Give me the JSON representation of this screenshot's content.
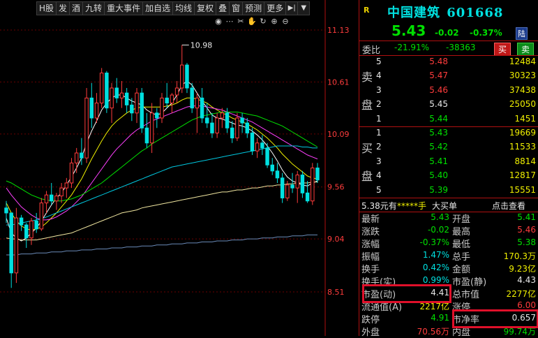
{
  "toolbar": {
    "items": [
      "H股",
      "发",
      "酒",
      "九转",
      "重大事件",
      "加自选",
      "均线",
      "复权",
      "叠",
      "窗",
      "预测",
      "更多"
    ],
    "dropdown_arrow": "▼",
    "collapse_arrow": "▶|"
  },
  "chart_icons": [
    "eye-icon",
    "dots-icon",
    "scissors-icon",
    "hand-icon",
    "refresh-icon",
    "zoom-in-icon",
    "zoom-out-icon"
  ],
  "chart_data": {
    "type": "candlestick",
    "y_ticks": [
      "11.13",
      "10.61",
      "10.09",
      "9.56",
      "9.04",
      "8.51"
    ],
    "ylim": [
      8.51,
      11.13
    ],
    "annotation": "10.98",
    "ohlc": [
      [
        9.35,
        9.42,
        9.2,
        9.3
      ],
      [
        9.3,
        9.3,
        8.55,
        8.7
      ],
      [
        8.7,
        9.35,
        8.6,
        9.25
      ],
      [
        9.25,
        9.28,
        9.12,
        9.18
      ],
      [
        9.18,
        9.2,
        8.95,
        9.05
      ],
      [
        9.05,
        9.25,
        8.98,
        9.22
      ],
      [
        9.22,
        9.3,
        9.1,
        9.14
      ],
      [
        9.14,
        9.45,
        9.12,
        9.4
      ],
      [
        9.4,
        9.52,
        9.3,
        9.48
      ],
      [
        9.48,
        9.6,
        9.38,
        9.42
      ],
      [
        9.42,
        9.5,
        9.33,
        9.47
      ],
      [
        9.47,
        9.6,
        9.4,
        9.55
      ],
      [
        9.55,
        9.65,
        9.45,
        9.6
      ],
      [
        9.6,
        9.85,
        9.55,
        9.8
      ],
      [
        9.8,
        9.95,
        9.7,
        9.9
      ],
      [
        9.9,
        10.05,
        9.78,
        9.85
      ],
      [
        9.85,
        10.55,
        9.8,
        10.45
      ],
      [
        10.45,
        10.6,
        10.15,
        10.25
      ],
      [
        10.25,
        10.5,
        10.2,
        10.4
      ],
      [
        10.4,
        10.75,
        10.35,
        10.7
      ],
      [
        10.7,
        10.72,
        10.3,
        10.35
      ],
      [
        10.35,
        10.6,
        10.2,
        10.55
      ],
      [
        10.55,
        10.65,
        10.4,
        10.45
      ],
      [
        10.45,
        10.62,
        10.35,
        10.5
      ],
      [
        10.5,
        10.55,
        10.3,
        10.38
      ],
      [
        10.38,
        10.45,
        10.22,
        10.3
      ],
      [
        10.3,
        10.55,
        10.2,
        10.5
      ],
      [
        10.5,
        10.55,
        10.1,
        10.15
      ],
      [
        10.15,
        10.3,
        9.95,
        10.0
      ],
      [
        10.0,
        10.4,
        9.9,
        10.3
      ],
      [
        10.3,
        10.35,
        10.15,
        10.25
      ],
      [
        10.25,
        10.5,
        10.2,
        10.45
      ],
      [
        10.45,
        10.6,
        10.35,
        10.4
      ],
      [
        10.4,
        10.5,
        10.3,
        10.48
      ],
      [
        10.48,
        10.62,
        10.4,
        10.55
      ],
      [
        10.55,
        10.98,
        10.5,
        10.78
      ],
      [
        10.78,
        10.8,
        10.5,
        10.55
      ],
      [
        10.55,
        10.6,
        10.3,
        10.35
      ],
      [
        10.35,
        10.5,
        10.1,
        10.45
      ],
      [
        10.45,
        10.55,
        10.2,
        10.25
      ],
      [
        10.25,
        10.4,
        10.15,
        10.2
      ],
      [
        10.2,
        10.3,
        10.05,
        10.1
      ],
      [
        10.1,
        10.3,
        10.05,
        10.25
      ],
      [
        10.25,
        10.35,
        10.15,
        10.3
      ],
      [
        10.3,
        10.35,
        10.1,
        10.15
      ],
      [
        10.15,
        10.22,
        10.0,
        10.05
      ],
      [
        10.05,
        10.3,
        10.02,
        10.25
      ],
      [
        10.25,
        10.3,
        10.1,
        10.2
      ],
      [
        10.2,
        10.25,
        10.05,
        10.1
      ],
      [
        10.1,
        10.15,
        9.88,
        9.92
      ],
      [
        9.92,
        10.05,
        9.85,
        10.0
      ],
      [
        10.0,
        10.08,
        9.88,
        9.95
      ],
      [
        9.95,
        10.0,
        9.75,
        9.78
      ],
      [
        9.78,
        9.85,
        9.68,
        9.72
      ],
      [
        9.72,
        9.8,
        9.6,
        9.65
      ],
      [
        9.65,
        9.7,
        9.4,
        9.45
      ],
      [
        9.45,
        9.62,
        9.42,
        9.58
      ],
      [
        9.58,
        9.7,
        9.5,
        9.55
      ],
      [
        9.55,
        9.72,
        9.4,
        9.68
      ],
      [
        9.68,
        9.72,
        9.45,
        9.5
      ],
      [
        9.5,
        9.62,
        9.4,
        9.42
      ],
      [
        9.42,
        9.8,
        9.38,
        9.75
      ],
      [
        9.75,
        9.8,
        9.6,
        9.63
      ]
    ],
    "ma_lines": [
      {
        "color": "#ffffff",
        "values": [
          9.25,
          9.1,
          9.05,
          9.02,
          9.05,
          9.1,
          9.15,
          9.22,
          9.3,
          9.38,
          9.45,
          9.5,
          9.58,
          9.66,
          9.75,
          9.85,
          10.0,
          10.12,
          10.22,
          10.33,
          10.4,
          10.45,
          10.48,
          10.48,
          10.45,
          10.42,
          10.4,
          10.38,
          10.33,
          10.3,
          10.28,
          10.3,
          10.35,
          10.4,
          10.48,
          10.58,
          10.62,
          10.58,
          10.5,
          10.42,
          10.35,
          10.28,
          10.25,
          10.24,
          10.22,
          10.2,
          10.18,
          10.17,
          10.15,
          10.12,
          10.08,
          10.03,
          9.97,
          9.9,
          9.82,
          9.73,
          9.66,
          9.62,
          9.6,
          9.58,
          9.57,
          9.6,
          9.62
        ]
      },
      {
        "color": "#f0f000",
        "values": [
          9.4,
          9.3,
          9.22,
          9.17,
          9.14,
          9.13,
          9.14,
          9.16,
          9.2,
          9.25,
          9.3,
          9.36,
          9.42,
          9.48,
          9.56,
          9.64,
          9.74,
          9.84,
          9.93,
          10.02,
          10.1,
          10.17,
          10.22,
          10.26,
          10.3,
          10.33,
          10.35,
          10.36,
          10.36,
          10.36,
          10.36,
          10.36,
          10.37,
          10.38,
          10.4,
          10.43,
          10.45,
          10.45,
          10.44,
          10.42,
          10.4,
          10.36,
          10.33,
          10.3,
          10.28,
          10.25,
          10.23,
          10.21,
          10.19,
          10.16,
          10.13,
          10.09,
          10.05,
          10.0,
          9.95,
          9.89,
          9.84,
          9.79,
          9.75,
          9.71,
          9.67,
          9.65,
          9.64
        ]
      },
      {
        "color": "#ff40ff",
        "values": [
          9.55,
          9.48,
          9.42,
          9.36,
          9.32,
          9.28,
          9.25,
          9.23,
          9.23,
          9.24,
          9.26,
          9.29,
          9.32,
          9.36,
          9.41,
          9.46,
          9.53,
          9.6,
          9.67,
          9.74,
          9.81,
          9.88,
          9.94,
          9.99,
          10.04,
          10.09,
          10.13,
          10.16,
          10.19,
          10.22,
          10.24,
          10.26,
          10.28,
          10.3,
          10.32,
          10.34,
          10.36,
          10.37,
          10.37,
          10.37,
          10.36,
          10.35,
          10.34,
          10.33,
          10.31,
          10.29,
          10.27,
          10.25,
          10.23,
          10.21,
          10.18,
          10.15,
          10.12,
          10.09,
          10.06,
          10.03,
          10.0,
          9.97,
          9.94,
          9.91,
          9.88,
          9.86,
          9.84
        ]
      },
      {
        "color": "#00e000",
        "values": [
          9.62,
          9.6,
          9.57,
          9.54,
          9.51,
          9.48,
          9.46,
          9.44,
          9.43,
          9.42,
          9.42,
          9.42,
          9.43,
          9.44,
          9.46,
          9.48,
          9.51,
          9.54,
          9.57,
          9.6,
          9.64,
          9.68,
          9.72,
          9.76,
          9.8,
          9.84,
          9.88,
          9.92,
          9.95,
          9.99,
          10.02,
          10.05,
          10.08,
          10.11,
          10.14,
          10.17,
          10.2,
          10.23,
          10.25,
          10.27,
          10.28,
          10.29,
          10.3,
          10.31,
          10.31,
          10.31,
          10.31,
          10.3,
          10.29,
          10.28,
          10.27,
          10.25,
          10.23,
          10.21,
          10.19,
          10.17,
          10.14,
          10.11,
          10.08,
          10.05,
          10.02,
          9.99,
          9.96
        ]
      },
      {
        "color": "#00c8e0",
        "values": [
          9.18,
          9.18,
          9.19,
          9.2,
          9.21,
          9.22,
          9.23,
          9.24,
          9.26,
          9.28,
          9.3,
          9.32,
          9.34,
          9.36,
          9.38,
          9.4,
          9.42,
          9.44,
          9.46,
          9.48,
          9.5,
          9.52,
          9.54,
          9.56,
          9.58,
          9.6,
          9.62,
          9.64,
          9.66,
          9.68,
          9.7,
          9.72,
          9.74,
          9.76,
          9.77,
          9.78,
          9.79,
          9.8,
          9.81,
          9.82,
          9.83,
          9.84,
          9.85,
          9.86,
          9.87,
          9.88,
          9.89,
          9.9,
          9.91,
          9.92,
          9.93,
          9.94,
          9.95,
          9.96,
          9.97,
          9.97,
          9.97,
          9.97,
          9.97,
          9.96,
          9.96,
          9.95,
          9.95
        ]
      },
      {
        "color": "#f0e6a0",
        "values": [
          9.05,
          9.04,
          9.04,
          9.03,
          9.03,
          9.03,
          9.03,
          9.04,
          9.05,
          9.06,
          9.07,
          9.08,
          9.09,
          9.1,
          9.12,
          9.14,
          9.16,
          9.18,
          9.2,
          9.22,
          9.24,
          9.26,
          9.28,
          9.3,
          9.31,
          9.32,
          9.33,
          9.35,
          9.36,
          9.37,
          9.38,
          9.39,
          9.4,
          9.41,
          9.42,
          9.43,
          9.44,
          9.45,
          9.46,
          9.47,
          9.48,
          9.49,
          9.5,
          9.51,
          9.51,
          9.52,
          9.53,
          9.53,
          9.54,
          9.55,
          9.55,
          9.56,
          9.57,
          9.57,
          9.58,
          9.58,
          9.59,
          9.59,
          9.6,
          9.6,
          9.6,
          9.61,
          9.61
        ]
      },
      {
        "color": "#6a8ab8",
        "values": [
          8.88,
          8.88,
          8.88,
          8.89,
          8.89,
          8.89,
          8.9,
          8.9,
          8.9,
          8.91,
          8.91,
          8.91,
          8.92,
          8.92,
          8.92,
          8.93,
          8.93,
          8.93,
          8.94,
          8.94,
          8.94,
          8.95,
          8.95,
          8.95,
          8.96,
          8.96,
          8.96,
          8.97,
          8.97,
          8.97,
          8.98,
          8.98,
          8.98,
          8.99,
          8.99,
          8.99,
          9.0,
          9.0,
          9.0,
          9.01,
          9.01,
          9.01,
          9.02,
          9.02,
          9.02,
          9.03,
          9.03,
          9.03,
          9.04,
          9.04,
          9.04,
          9.05,
          9.05,
          9.05,
          9.06,
          9.06,
          9.06,
          9.07,
          9.07,
          9.07,
          9.08,
          9.08,
          9.08
        ]
      }
    ]
  },
  "quote": {
    "badge": "R",
    "name": "中国建筑",
    "code": "601668",
    "price": "5.43",
    "change": "-0.02",
    "change_pct": "-0.37%",
    "market_tag": "陆",
    "weibi_label": "委比",
    "weibi_pct": "-21.91%",
    "weicha": "-38363",
    "buy_btn": "买",
    "sell_btn": "卖",
    "sell_side_label": [
      "卖",
      "盘"
    ],
    "buy_side_label": [
      "买",
      "盘"
    ],
    "sells": [
      {
        "level": "5",
        "price": "5.48",
        "vol": "12484"
      },
      {
        "level": "4",
        "price": "5.47",
        "vol": "30323"
      },
      {
        "level": "3",
        "price": "5.46",
        "vol": "37438"
      },
      {
        "level": "2",
        "price": "5.45",
        "vol": "25050"
      },
      {
        "level": "1",
        "price": "5.44",
        "vol": "1451"
      }
    ],
    "buys": [
      {
        "level": "1",
        "price": "5.43",
        "vol": "19669"
      },
      {
        "level": "2",
        "price": "5.42",
        "vol": "11533"
      },
      {
        "level": "3",
        "price": "5.41",
        "vol": "8814"
      },
      {
        "level": "4",
        "price": "5.40",
        "vol": "12817"
      },
      {
        "level": "5",
        "price": "5.39",
        "vol": "15551"
      }
    ],
    "bigorder": {
      "text1": "5.38元有",
      "text2": "*****手",
      "text3": "大买单",
      "link": "点击查看"
    },
    "stats": [
      {
        "l1": "最新",
        "v1": "5.43",
        "c1": "green",
        "l2": "开盘",
        "v2": "5.41",
        "c2": "green"
      },
      {
        "l1": "涨跌",
        "v1": "-0.02",
        "c1": "green",
        "l2": "最高",
        "v2": "5.46",
        "c2": "red"
      },
      {
        "l1": "涨幅",
        "v1": "-0.37%",
        "c1": "green",
        "l2": "最低",
        "v2": "5.38",
        "c2": "green"
      },
      {
        "l1": "振幅",
        "v1": "1.47%",
        "c1": "cyan",
        "l2": "总手",
        "v2": "170.3万",
        "c2": "yellow"
      },
      {
        "l1": "换手",
        "v1": "0.42%",
        "c1": "cyan",
        "l2": "金额",
        "v2": "9.23亿",
        "c2": "yellow"
      },
      {
        "l1": "换手(实)",
        "v1": "0.99%",
        "c1": "cyan",
        "l2": "市盈(静)",
        "v2": "4.43",
        "c2": "white"
      },
      {
        "l1": "市盈(动)",
        "v1": "4.41",
        "c1": "white",
        "l2": "总市值",
        "v2": "2277亿",
        "c2": "yellow"
      },
      {
        "l1": "流通值(A)",
        "v1": "2217亿",
        "c1": "yellow",
        "l2": "涨停",
        "v2": "6.00",
        "c2": "red"
      },
      {
        "l1": "跌停",
        "v1": "4.91",
        "c1": "green",
        "l2": "市净率",
        "v2": "0.657",
        "c2": "white"
      },
      {
        "l1": "外盘",
        "v1": "70.56万",
        "c1": "red",
        "l2": "内盘",
        "v2": "99.74万",
        "c2": "green"
      }
    ]
  }
}
